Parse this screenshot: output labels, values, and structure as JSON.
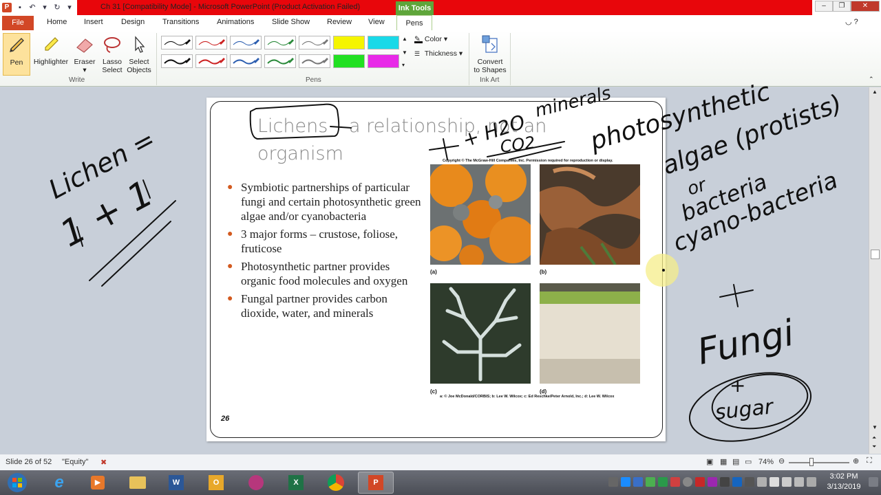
{
  "window": {
    "title": "Ch 31 [Compatibility Mode]  -  Microsoft PowerPoint (Product Activation Failed)",
    "context_tab": "Ink Tools",
    "app_icon": "powerpoint-icon"
  },
  "tabs": [
    "File",
    "Home",
    "Insert",
    "Design",
    "Transitions",
    "Animations",
    "Slide Show",
    "Review",
    "View",
    "Pens"
  ],
  "ribbon": {
    "write_group": {
      "label": "Write",
      "buttons": [
        "Pen",
        "Highlighter",
        "Eraser",
        "Lasso Select",
        "Select Objects"
      ]
    },
    "pens_group": {
      "label": "Pens",
      "swatch_colors_row1": [
        "#111111",
        "#cc2222",
        "#2d5fb0",
        "#2a8a3a",
        "#777777",
        "#f5f500",
        "#19d9e8"
      ],
      "swatch_colors_row2": [
        "#111111",
        "#cc2222",
        "#2d5fb0",
        "#2a8a3a",
        "#777777",
        "#22e022",
        "#e82ae8"
      ],
      "color_label": "Color",
      "thickness_label": "Thickness"
    },
    "ink_art_group": {
      "label": "Ink Art",
      "convert_label_line1": "Convert",
      "convert_label_line2": "to Shapes"
    }
  },
  "slide": {
    "title_line1": "Lichens – a relationship, not an",
    "title_line2": "organism",
    "bullets": [
      "Symbiotic partnerships of particular fungi and certain photosynthetic green algae and/or cyanobacteria",
      "3 major forms – crustose, foliose, fruticose",
      "Photosynthetic partner provides organic food molecules and oxygen",
      "Fungal partner provides carbon dioxide, water, and minerals"
    ],
    "copyright": "Copyright © The McGraw-Hill Companies, Inc. Permission required for reproduction or display.",
    "photo_labels": [
      "(a)",
      "(b)",
      "(c)",
      "(d)"
    ],
    "credits": "a: © Joe McDonald/CORBIS; b: Lee W. Wilcox; c: Ed Reschke/Peter Arnold, Inc.; d: Lee W. Wilcox",
    "number": "26"
  },
  "handwriting": {
    "left_1": "Lichen =",
    "left_2": "1 + 1",
    "top_1": "+ H2O",
    "top_2": "minerals",
    "top_3": "CO2",
    "right_1": "photosynthetic",
    "right_2": "algae (protists)",
    "right_3": "or",
    "right_4": "bacteria",
    "right_5": "cyano-bacteria",
    "right_6": "+",
    "right_7": "Fungi",
    "right_8": "+",
    "right_9": "sugar"
  },
  "statusbar": {
    "slide_info": "Slide 26 of 52",
    "theme": "\"Equity\"",
    "zoom": "74%"
  },
  "taskbar": {
    "time": "3:02 PM",
    "date": "3/13/2019"
  }
}
